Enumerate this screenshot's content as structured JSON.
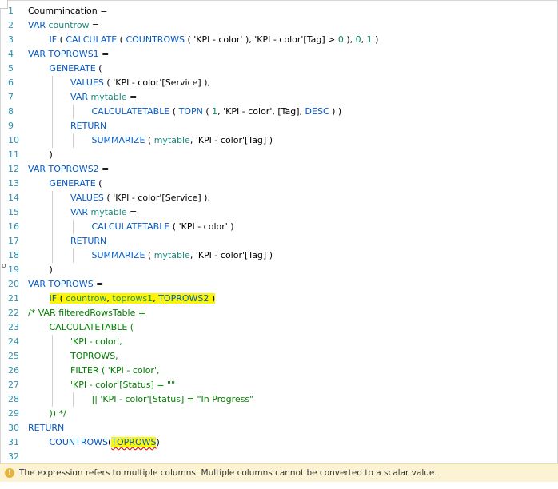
{
  "editor": {
    "line_numbers": [
      "1",
      "2",
      "3",
      "4",
      "5",
      "6",
      "7",
      "8",
      "9",
      "10",
      "11",
      "12",
      "13",
      "14",
      "15",
      "16",
      "17",
      "18",
      "19",
      "20",
      "21",
      "22",
      "23",
      "24",
      "25",
      "26",
      "27",
      "28",
      "29",
      "30",
      "31",
      "32"
    ],
    "lines": [
      {
        "n": 1,
        "indent": 0,
        "tokens": [
          {
            "t": "Coummincation =",
            "c": "op"
          }
        ]
      },
      {
        "n": 2,
        "indent": 0,
        "tokens": [
          {
            "t": "VAR ",
            "c": "kw"
          },
          {
            "t": "countrow",
            "c": "var"
          },
          {
            "t": " =",
            "c": "op"
          }
        ]
      },
      {
        "n": 3,
        "indent": 1,
        "tokens": [
          {
            "t": "IF",
            "c": "fn"
          },
          {
            "t": " ( ",
            "c": "op"
          },
          {
            "t": "CALCULATE",
            "c": "fn"
          },
          {
            "t": " ( ",
            "c": "op"
          },
          {
            "t": "COUNTROWS",
            "c": "fn"
          },
          {
            "t": " ( ",
            "c": "op"
          },
          {
            "t": "'KPI - color'",
            "c": "op"
          },
          {
            "t": " ), ",
            "c": "op"
          },
          {
            "t": "'KPI - color'[Tag]",
            "c": "op"
          },
          {
            "t": " > ",
            "c": "op"
          },
          {
            "t": "0",
            "c": "num"
          },
          {
            "t": " ), ",
            "c": "op"
          },
          {
            "t": "0",
            "c": "num"
          },
          {
            "t": ", ",
            "c": "op"
          },
          {
            "t": "1",
            "c": "num"
          },
          {
            "t": " )",
            "c": "op"
          }
        ]
      },
      {
        "n": 4,
        "indent": 0,
        "tokens": [
          {
            "t": "VAR ",
            "c": "kw"
          },
          {
            "t": "TOPROWS1",
            "c": "kw"
          },
          {
            "t": " =",
            "c": "op"
          }
        ]
      },
      {
        "n": 5,
        "indent": 1,
        "tokens": [
          {
            "t": "GENERATE",
            "c": "fn"
          },
          {
            "t": " (",
            "c": "op"
          }
        ]
      },
      {
        "n": 6,
        "indent": 2,
        "tokens": [
          {
            "t": "VALUES",
            "c": "fn"
          },
          {
            "t": " ( ",
            "c": "op"
          },
          {
            "t": "'KPI - color'[Service]",
            "c": "op"
          },
          {
            "t": " ),",
            "c": "op"
          }
        ]
      },
      {
        "n": 7,
        "indent": 2,
        "tokens": [
          {
            "t": "VAR ",
            "c": "kw"
          },
          {
            "t": "mytable",
            "c": "var"
          },
          {
            "t": " =",
            "c": "op"
          }
        ]
      },
      {
        "n": 8,
        "indent": 3,
        "tokens": [
          {
            "t": "CALCULATETABLE",
            "c": "fn"
          },
          {
            "t": " ( ",
            "c": "op"
          },
          {
            "t": "TOPN",
            "c": "fn"
          },
          {
            "t": " ( ",
            "c": "op"
          },
          {
            "t": "1",
            "c": "num"
          },
          {
            "t": ", ",
            "c": "op"
          },
          {
            "t": "'KPI - color'",
            "c": "op"
          },
          {
            "t": ", [Tag], ",
            "c": "op"
          },
          {
            "t": "DESC",
            "c": "kw"
          },
          {
            "t": " ) )",
            "c": "op"
          }
        ]
      },
      {
        "n": 9,
        "indent": 2,
        "tokens": [
          {
            "t": "RETURN",
            "c": "kw"
          }
        ]
      },
      {
        "n": 10,
        "indent": 3,
        "tokens": [
          {
            "t": "SUMMARIZE",
            "c": "fn"
          },
          {
            "t": " ( ",
            "c": "op"
          },
          {
            "t": "mytable",
            "c": "var"
          },
          {
            "t": ", ",
            "c": "op"
          },
          {
            "t": "'KPI - color'[Tag]",
            "c": "op"
          },
          {
            "t": " )",
            "c": "op"
          }
        ]
      },
      {
        "n": 11,
        "indent": 1,
        "tokens": [
          {
            "t": ")",
            "c": "op"
          }
        ]
      },
      {
        "n": 12,
        "indent": 0,
        "tokens": [
          {
            "t": "VAR ",
            "c": "kw"
          },
          {
            "t": "TOPROWS2",
            "c": "kw"
          },
          {
            "t": " =",
            "c": "op"
          }
        ]
      },
      {
        "n": 13,
        "indent": 1,
        "tokens": [
          {
            "t": "GENERATE",
            "c": "fn"
          },
          {
            "t": " (",
            "c": "op"
          }
        ]
      },
      {
        "n": 14,
        "indent": 2,
        "tokens": [
          {
            "t": "VALUES",
            "c": "fn"
          },
          {
            "t": " ( ",
            "c": "op"
          },
          {
            "t": "'KPI - color'[Service]",
            "c": "op"
          },
          {
            "t": " ),",
            "c": "op"
          }
        ]
      },
      {
        "n": 15,
        "indent": 2,
        "tokens": [
          {
            "t": "VAR ",
            "c": "kw"
          },
          {
            "t": "mytable",
            "c": "var"
          },
          {
            "t": " =",
            "c": "op"
          }
        ]
      },
      {
        "n": 16,
        "indent": 3,
        "tokens": [
          {
            "t": "CALCULATETABLE",
            "c": "fn"
          },
          {
            "t": " ( ",
            "c": "op"
          },
          {
            "t": "'KPI - color'",
            "c": "op"
          },
          {
            "t": " )",
            "c": "op"
          }
        ]
      },
      {
        "n": 17,
        "indent": 2,
        "tokens": [
          {
            "t": "RETURN",
            "c": "kw"
          }
        ]
      },
      {
        "n": 18,
        "indent": 3,
        "tokens": [
          {
            "t": "SUMMARIZE",
            "c": "fn"
          },
          {
            "t": " ( ",
            "c": "op"
          },
          {
            "t": "mytable",
            "c": "var"
          },
          {
            "t": ", ",
            "c": "op"
          },
          {
            "t": "'KPI - color'[Tag]",
            "c": "op"
          },
          {
            "t": " )",
            "c": "op"
          }
        ]
      },
      {
        "n": 19,
        "indent": 1,
        "tokens": [
          {
            "t": ")",
            "c": "op"
          }
        ]
      },
      {
        "n": 20,
        "indent": 0,
        "tokens": [
          {
            "t": "VAR ",
            "c": "kw"
          },
          {
            "t": "TOPROWS",
            "c": "kw"
          },
          {
            "t": " =",
            "c": "op"
          }
        ]
      },
      {
        "n": 21,
        "indent": 1,
        "highlight": true,
        "tokens": [
          {
            "t": "IF",
            "c": "fn"
          },
          {
            "t": " ( ",
            "c": "op"
          },
          {
            "t": "countrow",
            "c": "var"
          },
          {
            "t": ", ",
            "c": "op"
          },
          {
            "t": "toprows1",
            "c": "var"
          },
          {
            "t": ", ",
            "c": "op"
          },
          {
            "t": "TOPROWS2",
            "c": "kw"
          },
          {
            "t": " )",
            "c": "op"
          }
        ]
      },
      {
        "n": 22,
        "indent": 0,
        "tokens": [
          {
            "t": "/* VAR filteredRowsTable =",
            "c": "cmt"
          }
        ]
      },
      {
        "n": 23,
        "indent": 1,
        "tokens": [
          {
            "t": "CALCULATETABLE (",
            "c": "cmt"
          }
        ]
      },
      {
        "n": 24,
        "indent": 2,
        "tokens": [
          {
            "t": "'KPI - color',",
            "c": "cmt"
          }
        ]
      },
      {
        "n": 25,
        "indent": 2,
        "tokens": [
          {
            "t": "TOPROWS,",
            "c": "cmt"
          }
        ]
      },
      {
        "n": 26,
        "indent": 2,
        "tokens": [
          {
            "t": "FILTER ( 'KPI - color',",
            "c": "cmt"
          }
        ]
      },
      {
        "n": 27,
        "indent": 2,
        "tokens": [
          {
            "t": "'KPI - color'[Status] = \"\"",
            "c": "cmt"
          }
        ]
      },
      {
        "n": 28,
        "indent": 3,
        "tokens": [
          {
            "t": "|| 'KPI - color'[Status] = \"In Progress\"",
            "c": "cmt"
          }
        ]
      },
      {
        "n": 29,
        "indent": 1,
        "tokens": [
          {
            "t": ")) */",
            "c": "cmt"
          }
        ]
      },
      {
        "n": 30,
        "indent": 0,
        "tokens": [
          {
            "t": "RETURN",
            "c": "kw"
          }
        ]
      },
      {
        "n": 31,
        "indent": 1,
        "tokens": [
          {
            "t": "COUNTROWS",
            "c": "fn"
          },
          {
            "t": "(",
            "c": "op"
          },
          {
            "t": "TOPROWS",
            "c": "squiggle-kw"
          },
          {
            "t": ")",
            "c": "op"
          }
        ]
      },
      {
        "n": 32,
        "indent": 0,
        "tokens": []
      }
    ],
    "fold_marker": "o"
  },
  "status": {
    "icon": "warning-icon",
    "icon_glyph": "!",
    "message": "The expression refers to multiple columns. Multiple columns cannot be converted to a scalar value."
  },
  "colors": {
    "keyword": "#035aca",
    "line_number": "#2b91af",
    "comment": "#008000",
    "number": "#098658",
    "variable": "#1a8a7a",
    "highlight": "#fcf505",
    "error_bar": "#fbf3d3",
    "warning": "#e8b339"
  }
}
